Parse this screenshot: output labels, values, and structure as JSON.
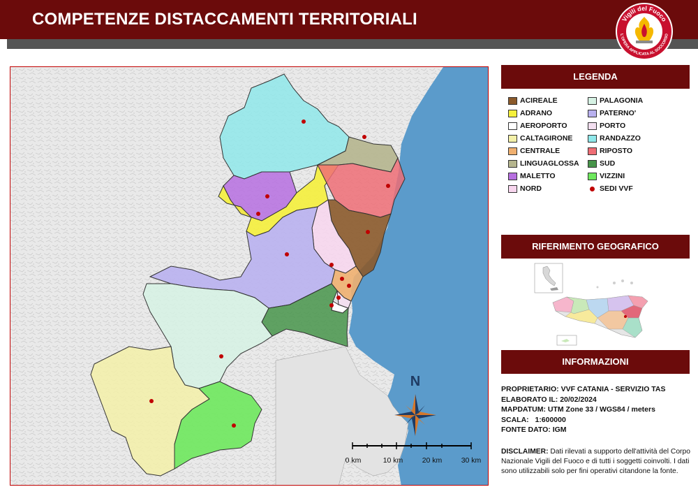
{
  "title": "COMPETENZE DISTACCAMENTI TERRITORIALI",
  "logo": {
    "icon": "vigili-del-fuoco-logo",
    "text_top": "Vigili del Fuoco",
    "text_bottom": "L'OPERA APPLICATA AL SOCCORSO"
  },
  "legend": {
    "title": "LEGENDA",
    "items": [
      {
        "label": "ACIREALE",
        "color": "#8b5a2b"
      },
      {
        "label": "ADRANO",
        "color": "#f5f03c"
      },
      {
        "label": "AEROPORTO",
        "color": "#ffffff"
      },
      {
        "label": "CALTAGIRONE",
        "color": "#f3f0a8"
      },
      {
        "label": "CENTRALE",
        "color": "#f0b070"
      },
      {
        "label": "LINGUAGLOSSA",
        "color": "#b5b58e"
      },
      {
        "label": "MALETTO",
        "color": "#b66fe0"
      },
      {
        "label": "NORD",
        "color": "#f8d6ee"
      },
      {
        "label": "PALAGONIA",
        "color": "#d6f2e4"
      },
      {
        "label": "PATERNO'",
        "color": "#b9b1ef"
      },
      {
        "label": "PORTO",
        "color": "#f3dff0"
      },
      {
        "label": "RANDAZZO",
        "color": "#8fe8ea"
      },
      {
        "label": "RIPOSTO",
        "color": "#ef6d75"
      },
      {
        "label": "SUD",
        "color": "#47944a"
      },
      {
        "label": "VIZZINI",
        "color": "#6ee85d"
      },
      {
        "label": "SEDI VVF",
        "color": "#c00000"
      }
    ]
  },
  "geo_ref": {
    "title": "RIFERIMENTO GEOGRAFICO"
  },
  "info": {
    "title": "INFORMAZIONI",
    "lines": [
      {
        "key": "PROPRIETARIO:",
        "value": "VVF CATANIA - SERVIZIO TAS"
      },
      {
        "key": "ELABORATO IL:",
        "value": "20/02/2024"
      },
      {
        "key": "MAPDATUM:",
        "value": "UTM Zone 33 / WGS84 / meters"
      },
      {
        "key": "SCALA:",
        "value": "1:600000"
      },
      {
        "key": "FONTE DATO:",
        "value": "IGM"
      }
    ],
    "disclaimer_label": "DISCLAIMER:",
    "disclaimer_text": "Dati rilevati a supporto dell'attività del Corpo Nazionale Vigili del Fuoco e di tutti i soggetti coinvolti. I dati sono utilizzabili solo per fini operativi citandone la fonte."
  },
  "map": {
    "north_label": "N",
    "scale_labels": [
      "0 km",
      "10 km",
      "20 km",
      "30 km"
    ],
    "sea_color": "#5b9bcb",
    "land_color": "#e9e9e9"
  }
}
